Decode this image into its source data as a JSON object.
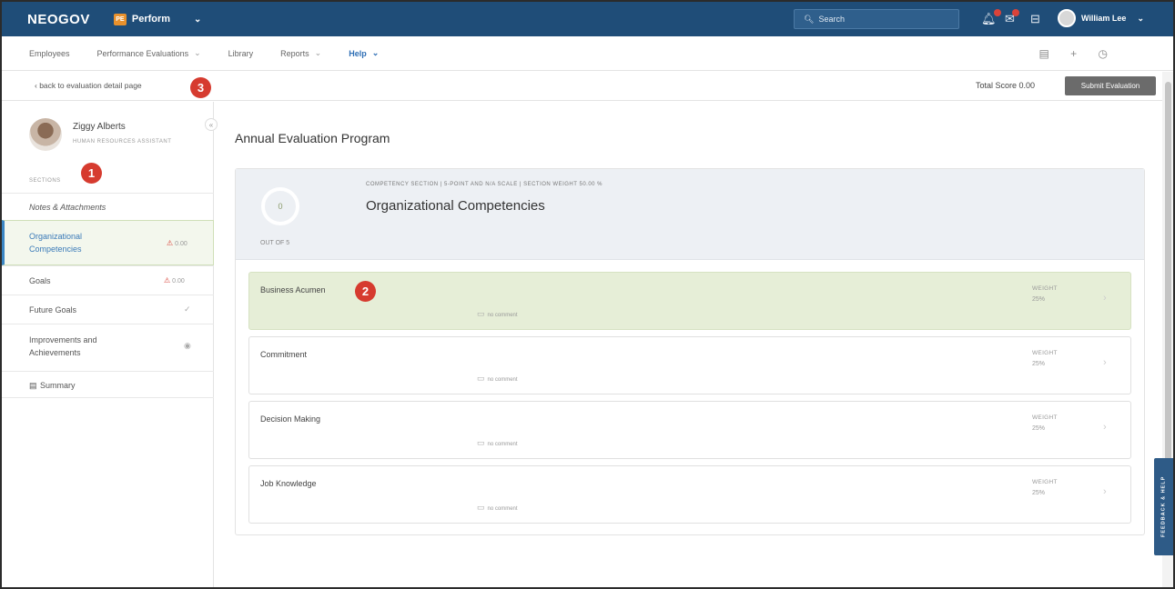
{
  "topbar": {
    "logo": "NEOGOV",
    "product_badge": "PE",
    "product_name": "Perform",
    "search_placeholder": "Search",
    "user_name": "William Lee",
    "colors": {
      "bar": "#1f4d78",
      "notification": "#d9433a",
      "product_badge": "#e8912d"
    }
  },
  "nav": {
    "items": [
      "Employees",
      "Performance Evaluations",
      "Library",
      "Reports",
      "Help"
    ]
  },
  "subbar": {
    "back_link": "‹ back to evaluation detail page",
    "total_score": "Total Score 0.00",
    "submit_label": "Submit Evaluation"
  },
  "markers": [
    "1",
    "2",
    "3"
  ],
  "sidebar": {
    "person_name": "Ziggy Alberts",
    "person_role": "HUMAN RESOURCES ASSISTANT",
    "sections_label": "SECTIONS",
    "items": [
      {
        "label": "Notes & Attachments"
      },
      {
        "label": "Organizational Competencies",
        "warning": "0.00",
        "active": true
      },
      {
        "label": "Goals",
        "warning": "0.00"
      },
      {
        "label": "Future Goals"
      },
      {
        "label": "Improvements and Achievements"
      },
      {
        "label": "Summary"
      }
    ]
  },
  "main": {
    "title": "Annual Evaluation Program",
    "section": {
      "meta": "COMPETENCY SECTION | 5-POINT AND N/A SCALE | SECTION WEIGHT 50.00 %",
      "title": "Organizational Competencies",
      "score": "0",
      "out_of": "OUT OF 5"
    },
    "competencies": [
      {
        "name": "Business Acumen",
        "comment": "no comment",
        "weight_label": "WEIGHT",
        "weight": "25%",
        "active": true
      },
      {
        "name": "Commitment",
        "comment": "no comment",
        "weight_label": "WEIGHT",
        "weight": "25%"
      },
      {
        "name": "Decision Making",
        "comment": "no comment",
        "weight_label": "WEIGHT",
        "weight": "25%"
      },
      {
        "name": "Job Knowledge",
        "comment": "no comment",
        "weight_label": "WEIGHT",
        "weight": "25%"
      }
    ]
  },
  "feedback_label": "FEEDBACK & HELP"
}
